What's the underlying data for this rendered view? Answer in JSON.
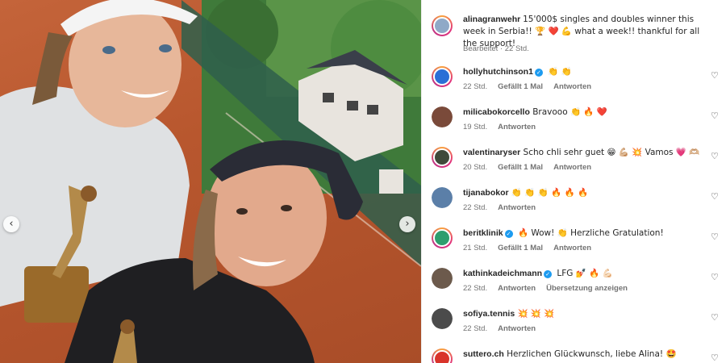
{
  "post": {
    "author": "alinagranwehr",
    "caption": "15'000$ singles and doubles winner this week in Serbia!! 🏆 ❤️ 💪  what a week!! thankful for all the support!",
    "meta": "Bearbeitet · 22 Std.",
    "story_ring": true
  },
  "carousel": {
    "prev_icon": "‹",
    "next_icon": "›"
  },
  "labels": {
    "reply": "Antworten",
    "translate": "Übersetzung anzeigen"
  },
  "comments": [
    {
      "user": "hollyhutchinson1",
      "verified": true,
      "text": "👏 👏",
      "time": "22 Std.",
      "likes": "Gefällt 1 Mal",
      "translate": false,
      "story": true,
      "avatar_color": "#2a6fd6"
    },
    {
      "user": "milicabokorcello",
      "verified": false,
      "text": "Bravooo 👏 🔥 ❤️",
      "time": "19 Std.",
      "likes": "",
      "translate": false,
      "story": false,
      "avatar_color": "#7a4a3a"
    },
    {
      "user": "valentinaryser",
      "verified": false,
      "text": "Scho chli sehr guet 😁 💪🏼 💥  Vamos 💗 🫶🏼",
      "time": "20 Std.",
      "likes": "Gefällt 1 Mal",
      "translate": false,
      "story": true,
      "avatar_color": "#3f4a3a"
    },
    {
      "user": "tijanabokor",
      "verified": false,
      "text": "👏 👏 👏 🔥 🔥 🔥",
      "time": "22 Std.",
      "likes": "",
      "translate": false,
      "story": false,
      "avatar_color": "#5b7fa8"
    },
    {
      "user": "beritklinik",
      "verified": true,
      "text": "🔥 Wow! 👏 Herzliche Gratulation!",
      "time": "21 Std.",
      "likes": "Gefällt 1 Mal",
      "translate": false,
      "story": true,
      "avatar_color": "#2e9e6e"
    },
    {
      "user": "kathinkadeichmann",
      "verified": true,
      "text": "LFG 💅 🔥 💪🏻",
      "time": "22 Std.",
      "likes": "",
      "translate": true,
      "story": false,
      "avatar_color": "#6c5a4c"
    },
    {
      "user": "sofiya.tennis",
      "verified": false,
      "text": "💥 💥 💥",
      "time": "22 Std.",
      "likes": "",
      "translate": false,
      "story": false,
      "avatar_color": "#4b4b4b"
    },
    {
      "user": "suttero.ch",
      "verified": false,
      "text": "Herzlichen Glückwunsch, liebe Alina! 🤩",
      "time": "",
      "likes": "",
      "translate": false,
      "story": true,
      "avatar_color": "#d9342b"
    }
  ],
  "icons": {
    "heart": "heart-outline-icon",
    "verified": "verified-badge-icon",
    "prev": "chevron-left-icon",
    "next": "chevron-right-icon"
  },
  "colors": {
    "clay": "#b8572e",
    "verified": "#1d9bf0",
    "meta_text": "#737373"
  }
}
